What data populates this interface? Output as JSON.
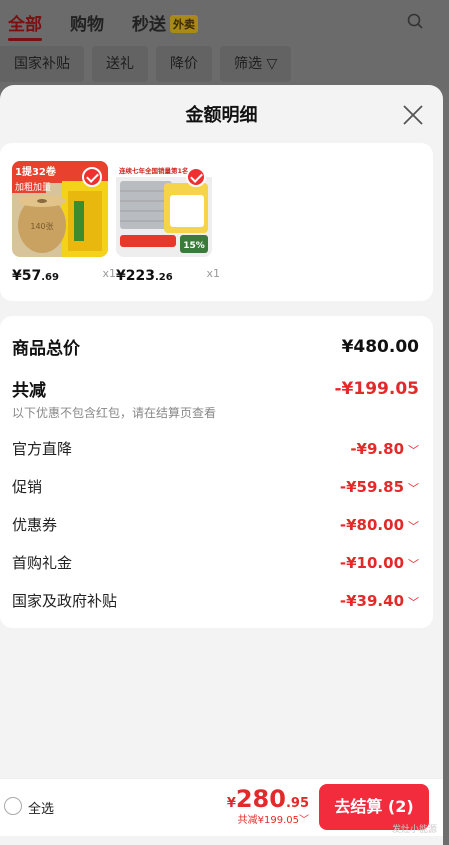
{
  "header": {
    "tabs": [
      {
        "label": "全部",
        "active": true
      },
      {
        "label": "购物"
      },
      {
        "label": "秒送",
        "badge": "外卖"
      }
    ],
    "filters": [
      "国家补贴",
      "送礼",
      "降价",
      "筛选"
    ]
  },
  "sheet": {
    "title": "金额明细",
    "products": [
      {
        "price_int": "¥57",
        "price_dec": ".69",
        "qty": "x1",
        "thumb_text": "140张",
        "banner": "1提32卷",
        "tag": "加粗加量"
      },
      {
        "price_int": "¥223",
        "price_dec": ".26",
        "qty": "x1",
        "banner": "连续七年全国销量第1名",
        "badge": "15%"
      }
    ],
    "details": {
      "total_label": "商品总价",
      "total_value": "¥480.00",
      "reduce_label": "共减",
      "reduce_value": "-¥199.05",
      "note": "以下优惠不包含红包，请在结算页查看",
      "items": [
        {
          "label": "官方直降",
          "value": "-¥9.80"
        },
        {
          "label": "促销",
          "value": "-¥59.85"
        },
        {
          "label": "优惠券",
          "value": "-¥80.00"
        },
        {
          "label": "首购礼金",
          "value": "-¥10.00"
        },
        {
          "label": "国家及政府补贴",
          "value": "-¥39.40"
        }
      ]
    }
  },
  "bottom": {
    "select_all": "全选",
    "currency": "¥",
    "amount_int": "280",
    "amount_dec": ".95",
    "saved": "共减¥199.05",
    "checkout": "去结算 (2)",
    "watermark": "发灶小能源"
  },
  "colors": {
    "accent": "#f22c3d",
    "discount": "#e32a2a"
  }
}
